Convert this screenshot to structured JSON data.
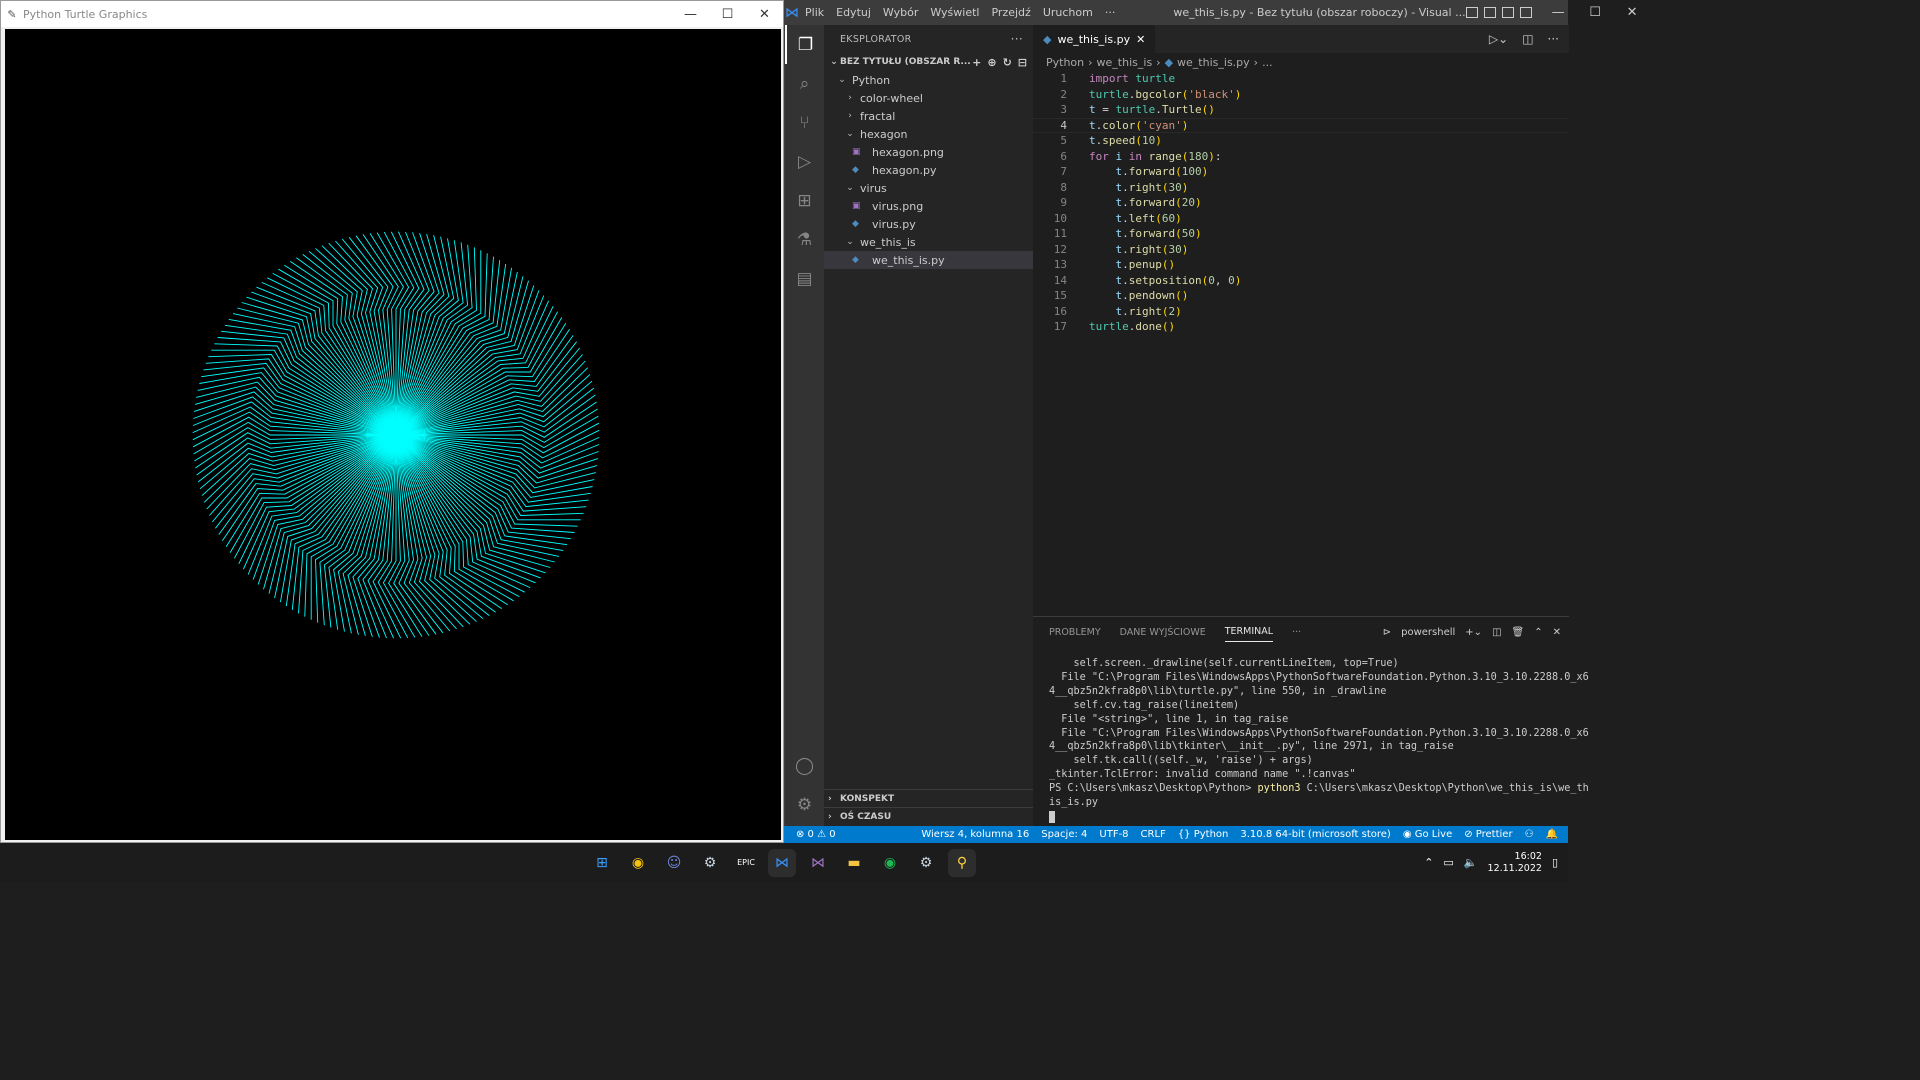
{
  "turtle_window": {
    "title": "Python Turtle Graphics",
    "controls": {
      "minimize": "—",
      "maximize": "☐",
      "close": "✕"
    },
    "canvas": {
      "background": "#000000",
      "stroke": "#00ffff",
      "iterations": 180,
      "turn_deg": 2
    }
  },
  "vscode": {
    "menu": [
      "Plik",
      "Edytuj",
      "Wybór",
      "Wyświetl",
      "Przejdź",
      "Uruchom",
      "···"
    ],
    "window_title": "we_this_is.py - Bez tytułu (obszar roboczy) - Visual ...",
    "controls": {
      "minimize": "—",
      "maximize": "☐",
      "close": "✕"
    },
    "activity_icons": [
      "explorer-icon",
      "search-icon",
      "source-control-icon",
      "run-debug-icon",
      "extensions-icon",
      "testing-icon",
      "notebook-icon"
    ],
    "sidebar": {
      "header": "EKSPLORATOR",
      "header_more": "···",
      "workspace": "BEZ TYTUŁU (OBSZAR R...",
      "tree": [
        {
          "label": "Python",
          "depth": 0,
          "type": "folder",
          "open": true
        },
        {
          "label": "color-wheel",
          "depth": 1,
          "type": "folder",
          "open": false
        },
        {
          "label": "fractal",
          "depth": 1,
          "type": "folder",
          "open": false
        },
        {
          "label": "hexagon",
          "depth": 1,
          "type": "folder",
          "open": true
        },
        {
          "label": "hexagon.png",
          "depth": 2,
          "type": "png"
        },
        {
          "label": "hexagon.py",
          "depth": 2,
          "type": "py"
        },
        {
          "label": "virus",
          "depth": 1,
          "type": "folder",
          "open": true
        },
        {
          "label": "virus.png",
          "depth": 2,
          "type": "png"
        },
        {
          "label": "virus.py",
          "depth": 2,
          "type": "py"
        },
        {
          "label": "we_this_is",
          "depth": 1,
          "type": "folder",
          "open": true
        },
        {
          "label": "we_this_is.py",
          "depth": 2,
          "type": "py",
          "selected": true
        }
      ],
      "outline": "KONSPEKT",
      "timeline": "OŚ CZASU"
    },
    "tab": {
      "label": "we_this_is.py",
      "close": "✕"
    },
    "breadcrumb": [
      "Python",
      "we_this_is",
      "we_this_is.py",
      "..."
    ],
    "current_line": 4,
    "code_lines": [
      "import turtle",
      "turtle.bgcolor('black')",
      "t = turtle.Turtle()",
      "t.color('cyan')",
      "t.speed(10)",
      "for i in range(180):",
      "    t.forward(100)",
      "    t.right(30)",
      "    t.forward(20)",
      "    t.left(60)",
      "    t.forward(50)",
      "    t.right(30)",
      "    t.penup()",
      "    t.setposition(0, 0)",
      "    t.pendown()",
      "    t.right(2)",
      "turtle.done()"
    ],
    "panel": {
      "tabs": [
        "PROBLEMY",
        "DANE WYJŚCIOWE",
        "TERMINAL"
      ],
      "active_tab": "TERMINAL",
      "more": "···",
      "shell": "powershell",
      "terminal_lines": [
        "    self.screen._drawline(self.currentLineItem, top=True)",
        "  File \"C:\\Program Files\\WindowsApps\\PythonSoftwareFoundation.Python.3.10_3.10.2288.0_x6",
        "4__qbz5n2kfra8p0\\lib\\turtle.py\", line 550, in _drawline",
        "    self.cv.tag_raise(lineitem)",
        "  File \"<string>\", line 1, in tag_raise",
        "  File \"C:\\Program Files\\WindowsApps\\PythonSoftwareFoundation.Python.3.10_3.10.2288.0_x6",
        "4__qbz5n2kfra8p0\\lib\\tkinter\\__init__.py\", line 2971, in tag_raise",
        "    self.tk.call((self._w, 'raise') + args)",
        "_tkinter.TclError: invalid command name \".!canvas\""
      ],
      "prompt": "PS C:\\Users\\mkasz\\Desktop\\Python> ",
      "command": "python3",
      "command_rest": " C:\\Users\\mkasz\\Desktop\\Python\\we_this_is\\we_th",
      "command_wrap": "is_is.py"
    },
    "status": {
      "problems": "⊗ 0 ⚠ 0",
      "position": "Wiersz 4, kolumna 16",
      "spaces": "Spacje: 4",
      "encoding": "UTF-8",
      "eol": "CRLF",
      "language": "{} Python",
      "interpreter": "3.10.8 64-bit (microsoft store)",
      "golive": "Go Live",
      "prettier": "Prettier"
    }
  },
  "taskbar": {
    "apps": [
      "windows-start-icon",
      "chrome-icon",
      "discord-icon",
      "steam-icon",
      "epic-games-icon",
      "vscode-icon",
      "visual-studio-icon",
      "file-explorer-icon",
      "spotify-icon",
      "steam-icon",
      "python-icon"
    ],
    "time": "16:02",
    "date": "12.11.2022"
  }
}
